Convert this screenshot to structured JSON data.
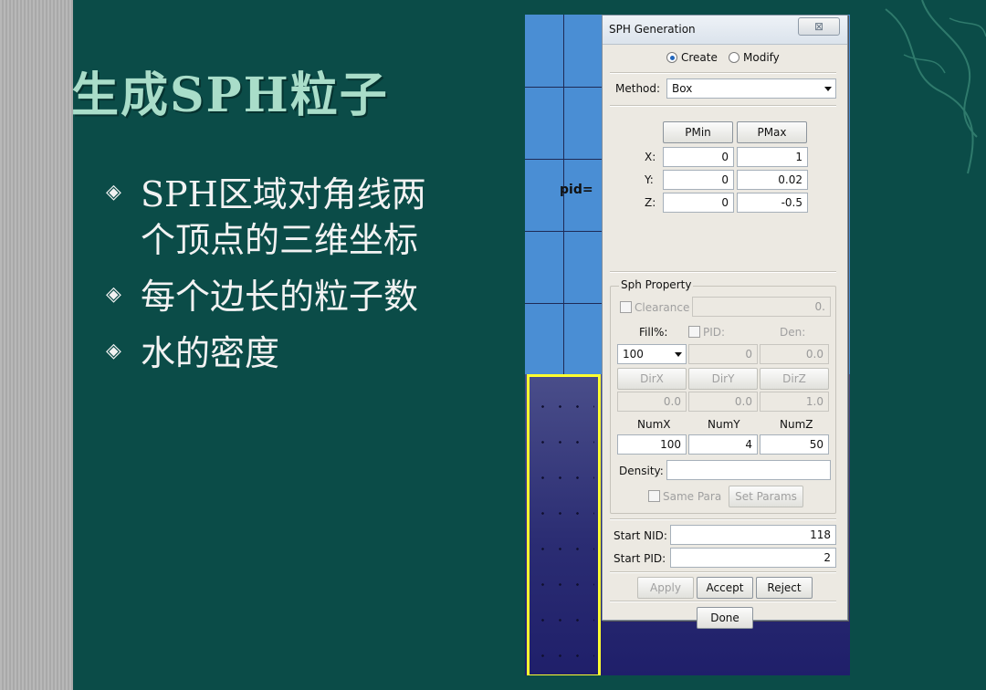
{
  "slide": {
    "title": "生成SPH粒子",
    "bullets": [
      "SPH区域对角线两个顶点的三维坐标",
      "每个边长的粒子数",
      "水的密度"
    ],
    "bullet_lines": [
      [
        "SPH区域对角线两",
        "个顶点的三维坐标"
      ],
      [
        "每个边长的粒子数"
      ],
      [
        "水的密度"
      ]
    ],
    "bullet_marker": "◈",
    "colors": {
      "background": "#0b4c48",
      "title": "#a9ddc9",
      "text": "#f2f2f2"
    }
  },
  "viewport": {
    "label": "pid=",
    "colors": {
      "part_top": "#4a8ed4",
      "part_bottom": "#2d2d6b",
      "highlight": "#ffff30"
    }
  },
  "dialog": {
    "title": "SPH Generation",
    "close_label": "⊠",
    "mode": {
      "create_label": "Create",
      "modify_label": "Modify",
      "selected": "Create"
    },
    "method": {
      "label": "Method:",
      "value": "Box"
    },
    "pmin_label": "PMin",
    "pmax_label": "PMax",
    "coords": [
      {
        "axis": "X:",
        "pmin": "0",
        "pmax": "1"
      },
      {
        "axis": "Y:",
        "pmin": "0",
        "pmax": "0.02"
      },
      {
        "axis": "Z:",
        "pmin": "0",
        "pmax": "-0.5"
      }
    ],
    "sph_property": {
      "title": "Sph Property",
      "clearance_label": "Clearance",
      "clearance_value": "0.",
      "fill_label": "Fill%:",
      "pid_label": "PID:",
      "den_label": "Den:",
      "fill_value": "100",
      "pid_value": "0",
      "den_value": "0.0",
      "dir_labels": [
        "DirX",
        "DirY",
        "DirZ"
      ],
      "dir_values": [
        "0.0",
        "0.0",
        "1.0"
      ],
      "num_labels": [
        "NumX",
        "NumY",
        "NumZ"
      ],
      "num_values": [
        "100",
        "4",
        "50"
      ],
      "density_label": "Density:",
      "density_value": "",
      "same_para_label": "Same Para",
      "set_params_label": "Set Params"
    },
    "start_nid_label": "Start NID:",
    "start_nid_value": "118",
    "start_pid_label": "Start PID:",
    "start_pid_value": "2",
    "apply_label": "Apply",
    "accept_label": "Accept",
    "reject_label": "Reject",
    "done_label": "Done"
  }
}
